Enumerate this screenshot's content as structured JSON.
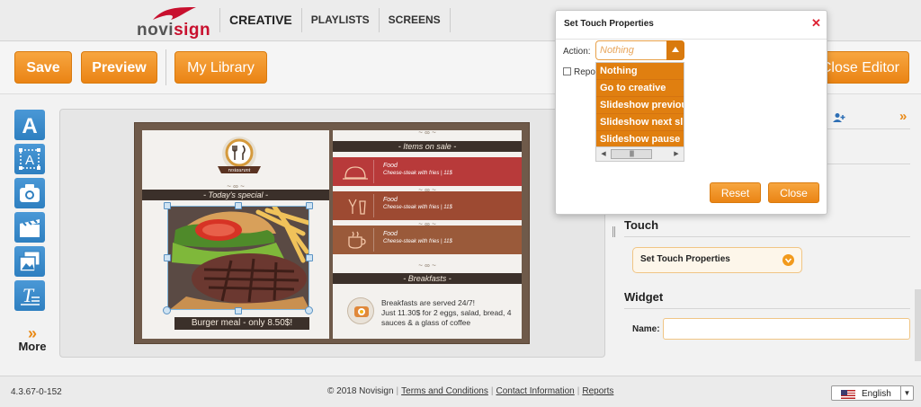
{
  "nav": {
    "logo_text_a": "novi",
    "logo_text_b": "sign",
    "links": [
      "CREATIVE",
      "PLAYLISTS",
      "SCREENS"
    ]
  },
  "toolbar": {
    "save_label": "Save",
    "preview_label": "Preview",
    "library_label": "My Library",
    "close_editor_label": "Close Editor"
  },
  "tools": {
    "icons": [
      "text-tool-icon",
      "textbox-tool-icon",
      "camera-icon",
      "clapperboard-icon",
      "gallery-icon",
      "rich-text-icon"
    ],
    "more_label": "More"
  },
  "creative": {
    "deco": "~ ∞ ~",
    "todays_special": "- Today's special -",
    "restaurant": "restaurant",
    "price_caption": "Burger meal - only 8.50$!",
    "items_on_sale": "- Items on sale -",
    "sale_items": [
      {
        "title": "Food",
        "desc": "Cheese-steak with fries | 11$",
        "color": "#b83a3a"
      },
      {
        "title": "Food",
        "desc": "Cheese-steak with fries | 11$",
        "color": "#9d4a32"
      },
      {
        "title": "Food",
        "desc": "Cheese-steak with fries | 11$",
        "color": "#9a5a3a"
      }
    ],
    "breakfasts_bar": "- Breakfasts -",
    "breakfast_text": "Breakfasts are served 24/7!\nJust 11.30$ for  2 eggs, salad, bread, 4 sauces & a glass of coffee"
  },
  "right_panel": {
    "touch_title": "Touch",
    "touch_select": "Set Touch Properties",
    "widget_title": "Widget",
    "name_label": "Name:",
    "name_value": ""
  },
  "modal": {
    "title": "Set Touch Properties",
    "action_label": "Action:",
    "action_value": "Nothing",
    "repeat_label": "Repo",
    "options": [
      "Nothing",
      "Go to creative",
      "Slideshow previous",
      "Slideshow next slide",
      "Slideshow pause"
    ],
    "reset_label": "Reset",
    "close_label": "Close"
  },
  "footer": {
    "version": "4.3.67-0-152",
    "copyright": "© 2018 Novisign",
    "terms": "Terms and Conditions",
    "contact": "Contact Information",
    "reports": "Reports",
    "language": "English"
  },
  "colors": {
    "accent_orange": "#ea8414",
    "tool_blue": "#2e7fc0",
    "brand_red": "#c8102e"
  }
}
